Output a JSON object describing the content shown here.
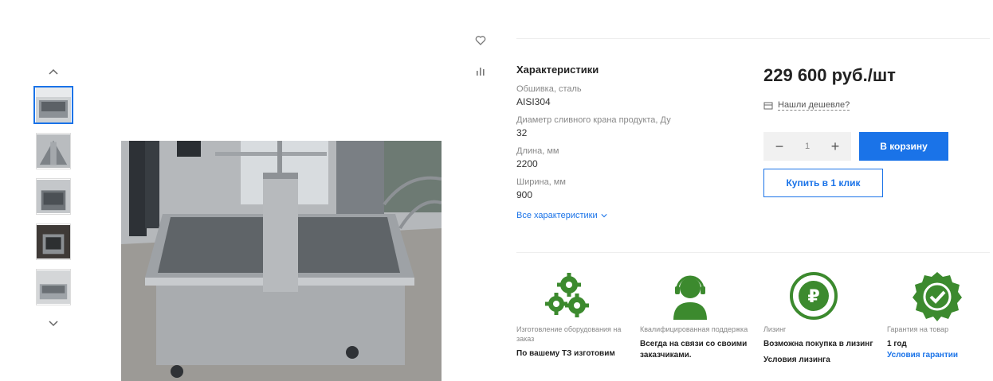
{
  "product": {
    "price": "229 600 руб./шт",
    "cheaper_link": "Нашли дешевле?",
    "quantity": "1",
    "add_to_cart": "В корзину",
    "buy_one_click": "Купить в 1 клик"
  },
  "specs": {
    "title": "Характеристики",
    "items": [
      {
        "key": "Обшивка, сталь",
        "value": "AISI304"
      },
      {
        "key": "Диаметр сливного крана продукта, Ду",
        "value": "32"
      },
      {
        "key": "Длина, мм",
        "value": "2200"
      },
      {
        "key": "Ширина, мм",
        "value": "900"
      }
    ],
    "all_link": "Все характеристики"
  },
  "features": [
    {
      "caption": "Изготовление оборудования на заказ",
      "value": "По вашему ТЗ изготовим",
      "link": ""
    },
    {
      "caption": "Квалифицированная поддержка",
      "value": "Всегда на связи со своими заказчиками.",
      "link": ""
    },
    {
      "caption": "Лизинг",
      "value": "Возможна покупка в лизинг",
      "link": "Условия лизинга"
    },
    {
      "caption": "Гарантия на товар",
      "value": "1 год",
      "link": "Условия гарантии"
    }
  ],
  "colors": {
    "accent": "#1a73e8",
    "feature_green": "#3c8a2e"
  },
  "icons": [
    "chevron-up-icon",
    "chevron-down-icon",
    "heart-icon",
    "compare-icon",
    "price-tag-icon",
    "gears-icon",
    "support-agent-icon",
    "ruble-coin-icon",
    "badge-check-icon"
  ]
}
